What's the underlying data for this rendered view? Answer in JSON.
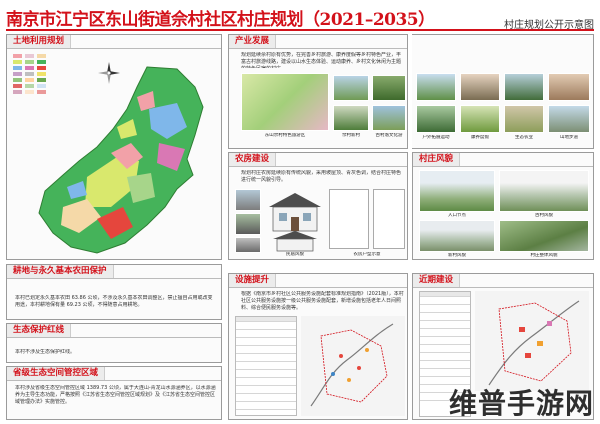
{
  "header": {
    "title": "南京市江宁区东山街道佘村社区村庄规划（2021–2035）",
    "subtitle": "村庄规划公开示意图"
  },
  "panels": {
    "land_use": {
      "title": "土地利用规划"
    },
    "industry": {
      "title": "产业发展",
      "text": "规划延续佘村原有优势，在完善乡村旅游、康养度假等乡村特色产业，丰富古村旅游线路，建设以山水生态体验、运动康养、乡村文化休闲为主题的特色民宿的村庄。",
      "captions": [
        "东山佘村特色旅游区",
        "佘村新村",
        "古村落文化游",
        "户外拓展运动",
        "康养度假",
        "生态农业",
        "山地步道"
      ]
    },
    "farm_building": {
      "title": "农房建设",
      "text": "规划村庄农房延续原有传统风貌，采用坡屋顶、青灰色调，结合村庄特色进行统一风貌引导。",
      "captions": [
        "民居风貌",
        "农房户型示意"
      ]
    },
    "village_style": {
      "title": "村庄风貌",
      "captions": [
        "入口节点",
        "古村风貌",
        "新村风貌",
        "村庄整体风貌"
      ]
    },
    "farmland": {
      "title": "耕地与永久基本农田保护",
      "text": "本村已划定永久基本农田 63.86 公顷，不涉及永久基本农田调整区，禁止擅自占用或改变用途，本村耕地保有量 69.23 公顷，不得随意占用耕地。"
    },
    "eco_redline": {
      "title": "生态保护红线",
      "text": "本村不涉及生态保护红线。"
    },
    "eco_space": {
      "title": "省级生态空间管控区域",
      "text": "本村涉及省级生态空间管控区域 1389.73 公顷，属于大连山-青龙山水源涵养区，以水源涵养为主导生态功能，严格按照《江苏省生态空间管控区域规划》及《江苏省生态空间管控区域管理办法》实施管控。"
    },
    "facilities": {
      "title": "设施提升",
      "text": "根据《南京市乡村社区公共服务设施配套标准规划指南》（2021版），本村社区公共服务设施按一级公共服务设施配套，新增设施包括老年人日间照料、综合便民服务设施等。"
    },
    "recent": {
      "title": "近期建设"
    }
  },
  "watermark": "维普手游网",
  "colors": {
    "accent": "#d3111a",
    "forest": "#45b35a",
    "water": "#7fb7ea",
    "village": "#f2a1a8",
    "farmland": "#d9e86d",
    "industry": "#d978b4"
  }
}
